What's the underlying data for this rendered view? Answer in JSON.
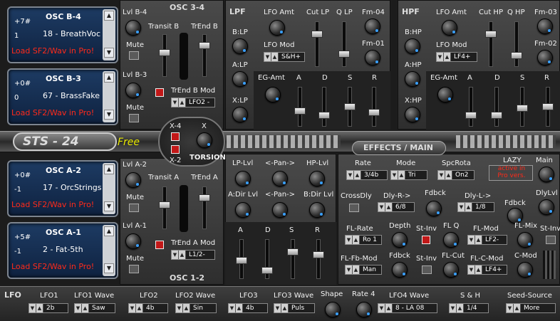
{
  "osc": {
    "b4": {
      "octave": "+7#",
      "tune": "1",
      "name": "OSC B-4",
      "patch": "18 - BreathVoc",
      "load": "Load SF2/Wav in Pro!"
    },
    "b3": {
      "octave": "+0#",
      "tune": "0",
      "name": "OSC B-3",
      "patch": "67 - BrassFake",
      "load": "Load SF2/Wav in Pro!"
    },
    "a2": {
      "octave": "+0#",
      "tune": "-1",
      "name": "OSC A-2",
      "patch": "17 - OrcStrings",
      "load": "Load SF2/Wav in Pro!"
    },
    "a1": {
      "octave": "+5#",
      "tune": "-1",
      "name": "OSC A-1",
      "patch": "2 - Fat-5th",
      "load": "Load SF2/Wav in Pro!"
    }
  },
  "mid": {
    "osc34": "OSC 3-4",
    "osc12": "OSC 1-2",
    "lvl_b4": "Lvl B-4",
    "lvl_b3": "Lvl B-3",
    "lvl_a2": "Lvl A-2",
    "lvl_a1": "Lvl A-1",
    "mute": "Mute",
    "transit_b": "Transit B",
    "trend_b": "TrEnd B",
    "transit_a": "Transit A",
    "trend_a": "TrEnd A",
    "trend_b_mod": "TrEnd B Mod",
    "trend_a_mod": "TrEnd A Mod",
    "trend_b_val": "LFO2 -",
    "trend_a_val": "L1/2-",
    "x4": "X-4",
    "x2": "X-2",
    "x": "X",
    "torsion": "TORSION"
  },
  "logo": {
    "name": "STS - 24",
    "edition": "Free"
  },
  "lpf": {
    "title": "LPF",
    "lfo_amt": "LFO Amt",
    "cut": "Cut LP",
    "q": "Q LP",
    "fm04": "Fm-04",
    "fm01": "Fm-01",
    "lfo_mod": "LFO Mod",
    "lfo_mod_val": "S&H+",
    "blp": "B:LP",
    "alp": "A:LP",
    "xlp": "X:LP",
    "eg": "EG-Amt",
    "a": "A",
    "d": "D",
    "s": "S",
    "r": "R"
  },
  "hpf": {
    "title": "HPF",
    "lfo_amt": "LFO Amt",
    "cut": "Cut HP",
    "q": "Q HP",
    "fm03": "Fm-03",
    "fm02": "Fm-02",
    "lfo_mod": "LFO Mod",
    "lfo_mod_val": "LF4+",
    "bhp": "B:HP",
    "ahp": "A:HP",
    "xhp": "X:HP",
    "eg": "EG-Amt",
    "a": "A",
    "d": "D",
    "s": "S",
    "r": "R"
  },
  "amp": {
    "lp": "LP-Lvl",
    "pan1": "<-Pan->",
    "hp": "HP-Lvl",
    "adir": "A:Dir Lvl",
    "pan2": "<-Pan->",
    "bdir": "B:Dir Lvl",
    "a": "A",
    "d": "D",
    "s": "S",
    "r": "R"
  },
  "fx": {
    "title": "EFFECTS / MAIN",
    "rate": "Rate",
    "rate_val": "3/4b",
    "mode": "Mode",
    "mode_val": "Tri",
    "spc": "SpcRota",
    "spc_val": "On2",
    "lazy": "LAZY",
    "lazy_note": "active in Pro vers.",
    "main": "Main",
    "crossdly": "CrossDly",
    "dlyr": "Dly-R->",
    "dlyr_val": "6/8",
    "fdbck1": "Fdbck",
    "dlyl": "Dly-L->",
    "dlyl_val": "1/8",
    "fdbck2": "Fdbck",
    "dlylvl": "DlyLvl",
    "flrate": "FL-Rate",
    "flrate_val": "Ro 1",
    "depth": "Depth",
    "stinv1": "St-Inv",
    "flq": "FL Q",
    "flmod": "FL-Mod",
    "flmod_val": "LF2-",
    "flmix": "FL-Mix",
    "stinv2": "St-Inv",
    "flfb": "FL-Fb-Mod",
    "flfb_val": "Man",
    "fdbck3": "Fdbck",
    "stinv3": "St-Inv",
    "flcut": "FL-Cut",
    "flcmod": "FL-C-Mod",
    "flcmod_val": "LF4+",
    "cmod": "C-Mod"
  },
  "lfo": {
    "title": "LFO",
    "l1": "LFO1",
    "l1v": "2b",
    "w1": "LFO1 Wave",
    "w1v": "Saw",
    "l2": "LFO2",
    "l2v": "4b",
    "w2": "LFO2 Wave",
    "w2v": "Sin",
    "l3": "LFO3",
    "l3v": "4b",
    "w3": "LFO3 Wave",
    "w3v": "Puls",
    "shape": "Shape",
    "r4": "Rate 4",
    "w4": "LFO4 Wave",
    "w4v": "8 - LA 08",
    "sh": "S & H",
    "shv": "1/4",
    "seed": "Seed-Source",
    "seedv": "More"
  },
  "colors": {
    "accent": "#3aa0ff",
    "warning": "#ff2a1a",
    "display": "#1d3b63",
    "logo_free": "#e8e800"
  }
}
